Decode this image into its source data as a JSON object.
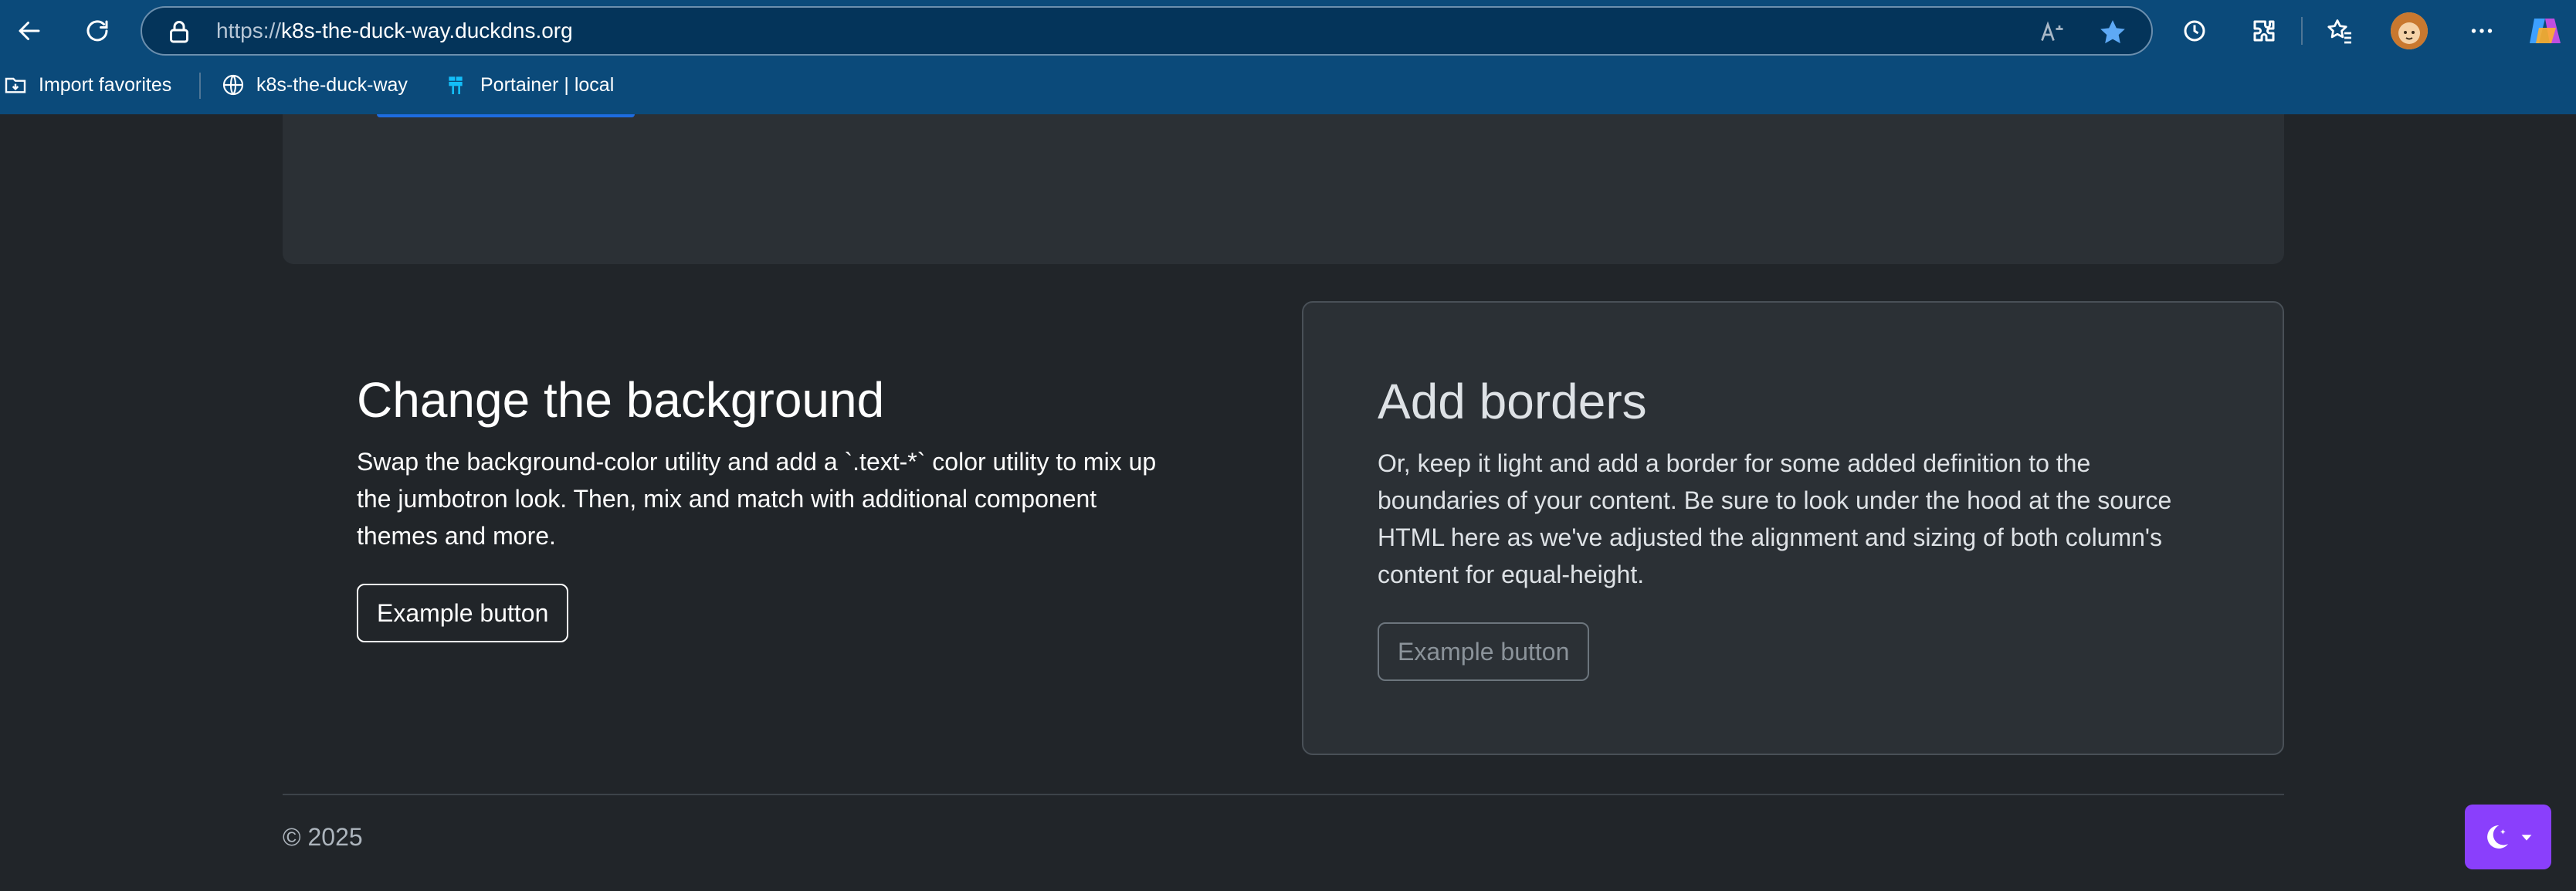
{
  "browser": {
    "url_scheme": "https://",
    "url_host": "k8s-the-duck-way.duckdns.org",
    "icons": [
      "back-icon",
      "refresh-icon",
      "lock-icon",
      "read-aloud-icon",
      "favorite-star-icon",
      "tracking-icon",
      "extensions-icon",
      "favorites-icon",
      "profile-avatar",
      "more-icon",
      "copilot-icon"
    ]
  },
  "bookmarks": [
    {
      "label": "Import favorites",
      "icon": "import-icon"
    },
    {
      "label": "k8s-the-duck-way",
      "icon": "globe-icon"
    },
    {
      "label": "Portainer | local",
      "icon": "portainer-icon"
    }
  ],
  "main": {
    "left": {
      "title": "Change the background",
      "text": "Swap the background-color utility and add a `.text-*` color utility to mix up the jumbotron look. Then, mix and match with additional component themes and more.",
      "button": "Example button"
    },
    "right": {
      "title": "Add borders",
      "text": "Or, keep it light and add a border for some added definition to the boundaries of your content. Be sure to look under the hood at the source HTML here as we've adjusted the alignment and sizing of both column's content for equal-height.",
      "button": "Example button"
    }
  },
  "footer": {
    "copyright": "© 2025"
  },
  "theme_toggle": {
    "icon": "moon-stars-icon",
    "accent": "#8a3ffc"
  }
}
